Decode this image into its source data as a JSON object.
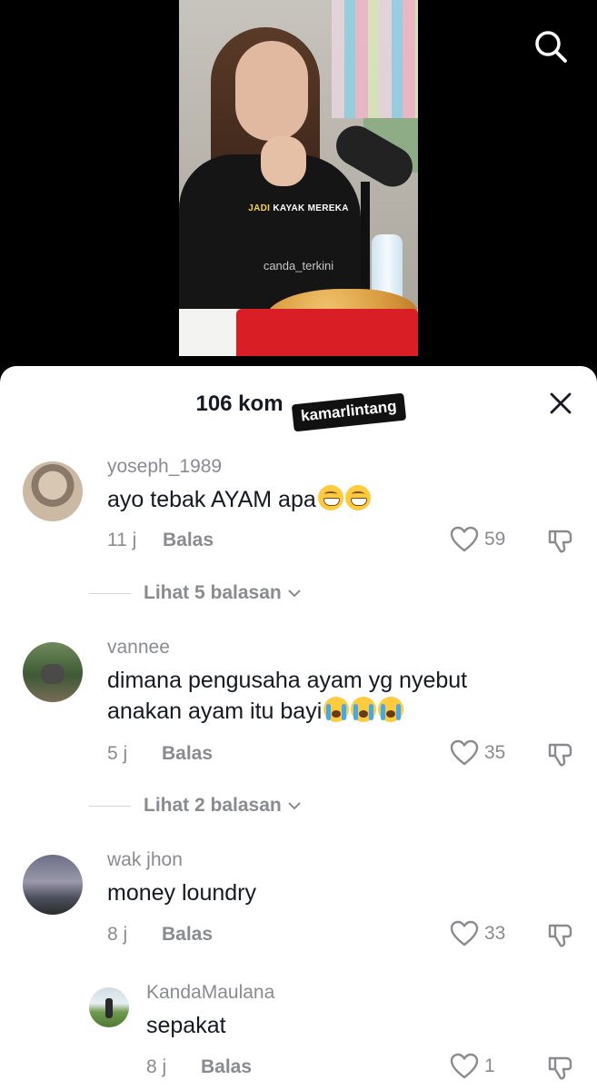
{
  "video": {
    "subtitle_highlight": "JADI",
    "subtitle_rest": " KAYAK MEREKA",
    "watermark": "canda_terkini"
  },
  "topbar": {
    "search_icon": "search-icon"
  },
  "sheet": {
    "title": "106 komentar",
    "title_visible": "106 kom",
    "sticker": "kamarlintang",
    "close_icon": "close-icon"
  },
  "comments": [
    {
      "username": "yoseph_1989",
      "text": "ayo tebak AYAM apa",
      "emojis": [
        "grin",
        "grin"
      ],
      "time": "11 j",
      "reply_label": "Balas",
      "likes": "59",
      "view_replies": "Lihat 5 balasan"
    },
    {
      "username": "vannee",
      "text_line1": "dimana pengusaha ayam yg nyebut",
      "text_line2": "anakan ayam itu bayi",
      "emojis": [
        "cry",
        "cry",
        "cry"
      ],
      "time": "5 j",
      "reply_label": "Balas",
      "likes": "35",
      "view_replies": "Lihat 2 balasan"
    },
    {
      "username": "wak jhon",
      "text": "money loundry",
      "time": "8 j",
      "reply_label": "Balas",
      "likes": "33"
    }
  ],
  "replies": [
    {
      "username": "KandaMaulana",
      "text": "sepakat",
      "time": "8 j",
      "reply_label": "Balas",
      "likes": "1"
    }
  ],
  "colors": {
    "text_primary": "#161823",
    "text_secondary": "#8a8b91",
    "sheet_bg": "#ffffff",
    "background": "#000000"
  }
}
